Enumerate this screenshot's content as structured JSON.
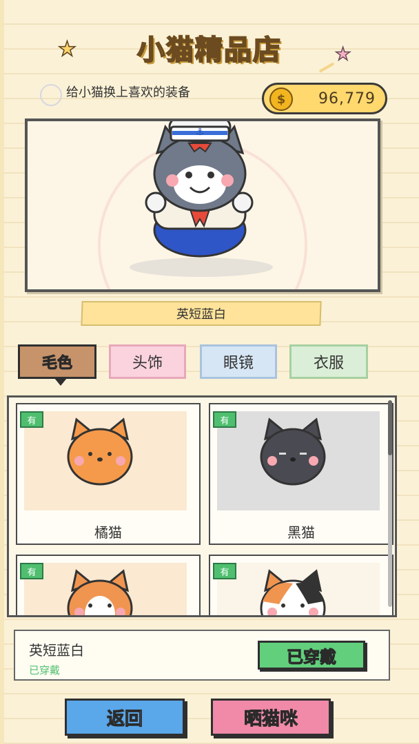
{
  "header": {
    "title": "小猫精品店",
    "subtitle": "给小猫换上喜欢的装备"
  },
  "currency": {
    "coins": "96,779",
    "icon": "coin-icon"
  },
  "preview": {
    "selected_name": "英短蓝白"
  },
  "tabs": [
    {
      "label": "毛色",
      "active": true
    },
    {
      "label": "头饰",
      "active": false
    },
    {
      "label": "眼镜",
      "active": false
    },
    {
      "label": "衣服",
      "active": false
    }
  ],
  "items": [
    {
      "name": "橘猫",
      "badge": "有",
      "color": "#f59a4a"
    },
    {
      "name": "黑猫",
      "badge": "有",
      "color": "#4a4a52"
    },
    {
      "name": "",
      "badge": "有",
      "color": "#f09550"
    },
    {
      "name": "",
      "badge": "有",
      "color": "#ffffff"
    }
  ],
  "info": {
    "name": "英短蓝白",
    "status": "已穿戴",
    "equip_label": "已穿戴"
  },
  "bottom": {
    "back_label": "返回",
    "share_label": "晒猫咪"
  },
  "colors": {
    "accent_green": "#4fbf6f",
    "back_blue": "#5aa7ea",
    "share_pink": "#f08aa8",
    "gold": "#ffd86e"
  }
}
